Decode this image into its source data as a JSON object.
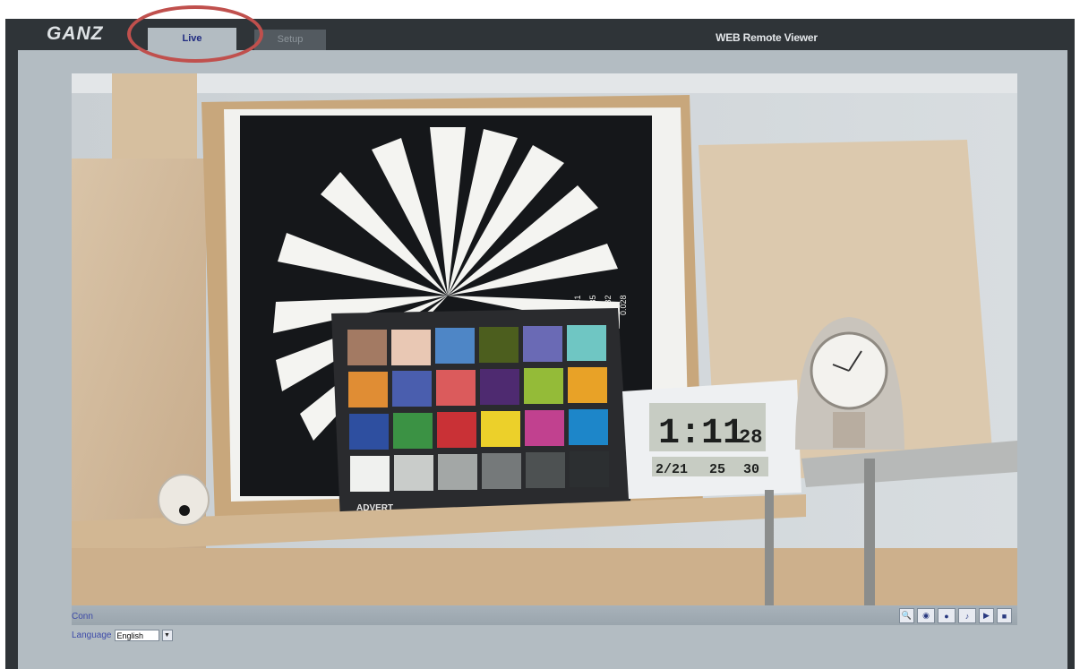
{
  "brand": {
    "logo_text": "GANZ"
  },
  "tabs": [
    {
      "label": "Live",
      "active": true
    },
    {
      "label": "Setup",
      "active": false
    }
  ],
  "app_title": "WEB Remote Viewer",
  "status": {
    "connection": "Conn"
  },
  "language": {
    "label": "Language",
    "selected": "English"
  },
  "controls": [
    {
      "name": "zoom-icon",
      "glyph": "🔍"
    },
    {
      "name": "snapshot-icon",
      "glyph": "◉"
    },
    {
      "name": "record-icon",
      "glyph": "●"
    },
    {
      "name": "audio-icon",
      "glyph": "♪"
    },
    {
      "name": "play-icon",
      "glyph": "▶"
    },
    {
      "name": "stop-icon",
      "glyph": "■"
    }
  ],
  "video_overlay": {
    "chart_brand": "ADVERT",
    "clock_time": "1:11",
    "clock_seconds": "28",
    "clock_date": "2/21",
    "clock_temp": "25",
    "clock_humidity": "30",
    "star_marks": [
      "0.041",
      "0.035",
      "0.032",
      "0.028"
    ]
  },
  "colors": {
    "accent_annotation": "#c0504d",
    "link_text": "#3d4aa8",
    "frame": "#2f3438",
    "content_bg": "#b3bcc2"
  }
}
